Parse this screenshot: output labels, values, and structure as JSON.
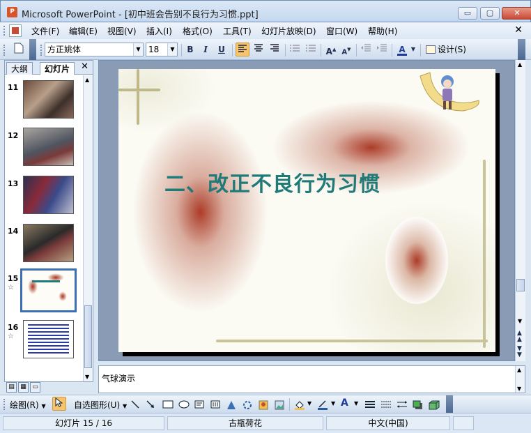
{
  "window": {
    "app_icon_letter": "P",
    "title": "Microsoft PowerPoint - [初中班会告别不良行为习惯.ppt]",
    "minimize": "▭",
    "maximize": "▢",
    "close": "✕"
  },
  "menu": {
    "items": [
      "文件(F)",
      "编辑(E)",
      "视图(V)",
      "插入(I)",
      "格式(O)",
      "工具(T)",
      "幻灯片放映(D)",
      "窗口(W)",
      "帮助(H)"
    ],
    "close": "✕"
  },
  "toolbar": {
    "font_name": "方正姚体",
    "font_size": "18",
    "bold": "B",
    "italic": "I",
    "underline": "U",
    "design_label": "设计(S)"
  },
  "left_pane": {
    "tab_outline": "大纲",
    "tab_slides": "幻灯片",
    "close": "✕",
    "slides": [
      {
        "num": "11",
        "star": ""
      },
      {
        "num": "12",
        "star": ""
      },
      {
        "num": "13",
        "star": ""
      },
      {
        "num": "14",
        "star": ""
      },
      {
        "num": "15",
        "star": "☆"
      },
      {
        "num": "16",
        "star": "☆"
      }
    ],
    "selected_slide": "15"
  },
  "slide": {
    "title": "二、改正不良行为习惯"
  },
  "notes": {
    "text": "气球演示"
  },
  "draw_toolbar": {
    "draw_label": "绘图(R)",
    "autoshapes_label": "自选图形(U)"
  },
  "status": {
    "slide_position": "幻灯片 15 / 16",
    "design_template": "古瓶荷花",
    "language": "中文(中国)"
  },
  "colors": {
    "title_teal": "#1f7a78",
    "balloon_red": "#a8321e",
    "selection_blue": "#3a6fb4"
  }
}
